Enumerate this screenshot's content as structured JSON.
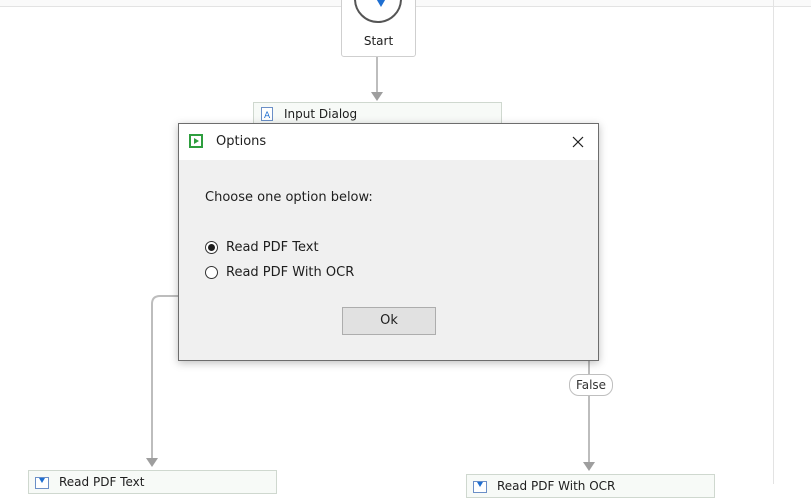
{
  "flow": {
    "start_label": "Start",
    "input_dialog_label": "Input Dialog",
    "false_label": "False",
    "read_pdf_text_label": "Read PDF Text",
    "read_pdf_ocr_label": "Read PDF With OCR"
  },
  "dialog": {
    "title": "Options",
    "prompt": "Choose one option below:",
    "options": [
      {
        "label": "Read PDF Text",
        "selected": true
      },
      {
        "label": "Read PDF With OCR",
        "selected": false
      }
    ],
    "ok_label": "Ok"
  },
  "colors": {
    "accent_green": "#2e9e3e",
    "start_blue": "#1f6fd1",
    "activity_icon_blue": "#1f6fd1"
  }
}
